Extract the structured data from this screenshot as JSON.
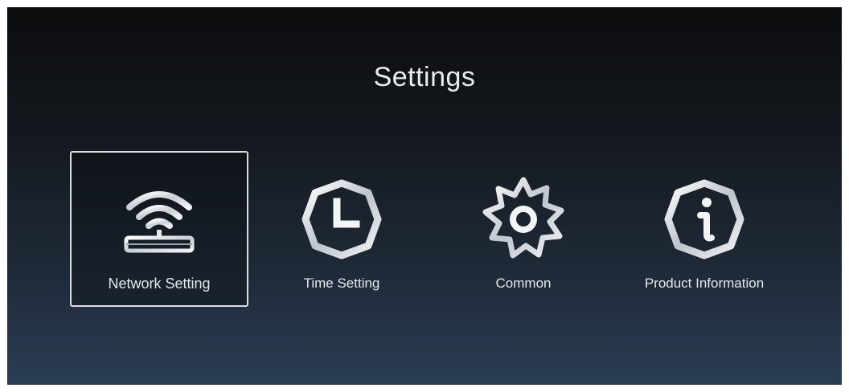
{
  "screen": {
    "title": "Settings"
  },
  "menu": {
    "items": [
      {
        "label": "Network Setting",
        "icon": "wifi-router-icon",
        "selected": true
      },
      {
        "label": "Time Setting",
        "icon": "clock-icon",
        "selected": false
      },
      {
        "label": "Common",
        "icon": "gear-icon",
        "selected": false
      },
      {
        "label": "Product Information",
        "icon": "info-icon",
        "selected": false
      }
    ]
  },
  "colors": {
    "background_top": "#0b0c0e",
    "background_bottom": "#2a3d55",
    "text": "#e6e8eb",
    "selection_border": "#d9dde2"
  }
}
